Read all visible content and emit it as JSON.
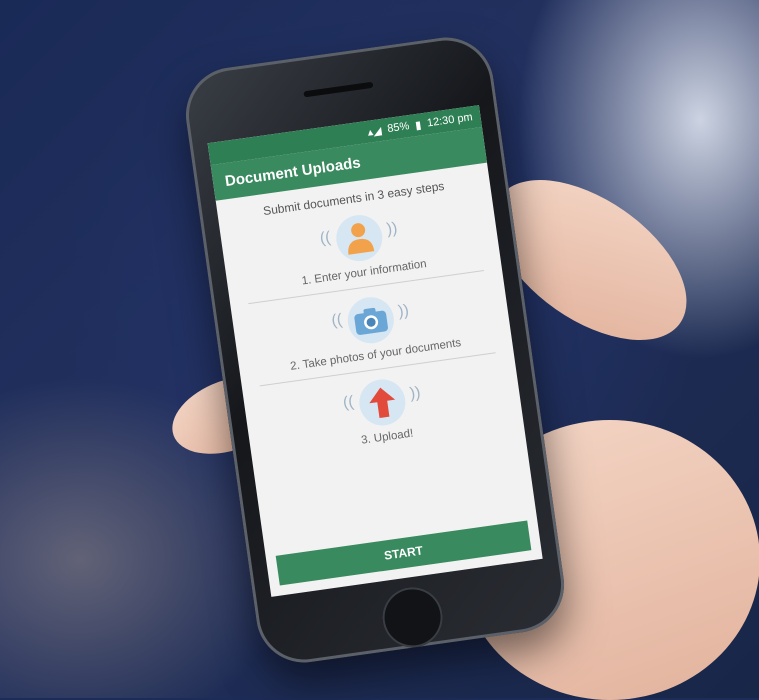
{
  "status_bar": {
    "battery": "85%",
    "time": "12:30 pm"
  },
  "app": {
    "title": "Document Uploads",
    "subtitle": "Submit documents in 3 easy steps"
  },
  "steps": [
    {
      "label": "1. Enter your information",
      "icon": "person-icon"
    },
    {
      "label": "2. Take photos of your documents",
      "icon": "camera-icon"
    },
    {
      "label": "3. Upload!",
      "icon": "upload-arrow-icon"
    }
  ],
  "actions": {
    "start_label": "START"
  },
  "colors": {
    "green": "#3a8a5f",
    "dark_green": "#2f7f55",
    "orange": "#f2a24a",
    "blue": "#6ba7d6",
    "red": "#e24a3b"
  }
}
